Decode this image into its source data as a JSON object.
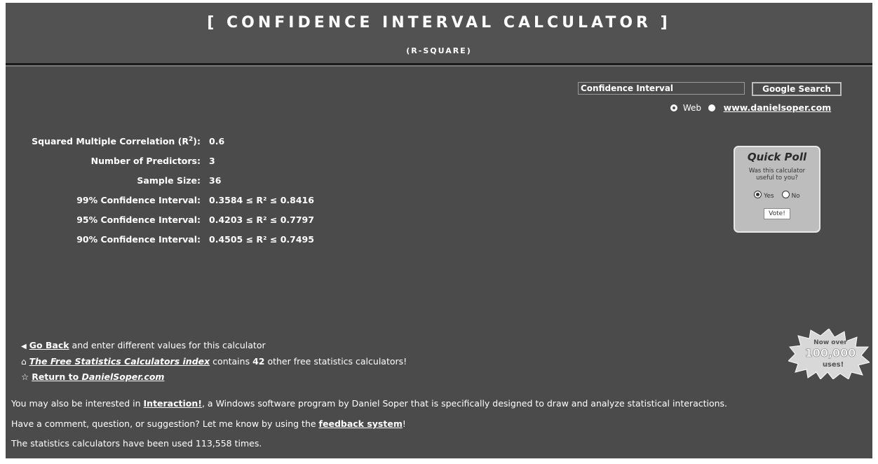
{
  "header": {
    "title": "[ CONFIDENCE INTERVAL CALCULATOR ]",
    "subtitle": "(R-SQUARE)"
  },
  "search": {
    "value": "Confidence Interval",
    "button_label": "Google Search",
    "option_web": "Web",
    "option_site": "www.danielsoper.com"
  },
  "results": {
    "rows": [
      {
        "label_pre": "Squared Multiple Correlation (R",
        "label_sup": "2",
        "label_post": "):",
        "value": "0.6"
      },
      {
        "label": "Number of Predictors:",
        "value": "3"
      },
      {
        "label": "Sample Size:",
        "value": "36"
      },
      {
        "label": "99% Confidence Interval:",
        "value": "0.3584 ≤ R² ≤ 0.8416"
      },
      {
        "label": "95% Confidence Interval:",
        "value": "0.4203 ≤ R² ≤ 0.7797"
      },
      {
        "label": "90% Confidence Interval:",
        "value": "0.4505 ≤ R² ≤ 0.7495"
      }
    ]
  },
  "poll": {
    "title": "Quick Poll",
    "question_line1": "Was this calculator",
    "question_line2": "useful to you?",
    "yes": "Yes",
    "no": "No",
    "vote_label": "Vote!"
  },
  "links": {
    "back_link": "Go Back",
    "back_rest": " and enter different values for this calculator",
    "index_link": "The Free Statistics Calculators index",
    "index_mid": " contains ",
    "index_count": "42",
    "index_rest": " other free statistics calculators!",
    "return_prefix": "Return to ",
    "return_site": "DanielSoper.com"
  },
  "badge": {
    "line1": "Now over",
    "line2": "100,000",
    "line3": "uses!"
  },
  "footer": {
    "interest_pre": "You may also be interested in ",
    "interest_link": "Interaction!",
    "interest_post": ", a Windows software program by Daniel Soper that is specifically designed to draw and analyze statistical interactions.",
    "comment_pre": "Have a comment, question, or suggestion? Let me know by using the ",
    "comment_link": "feedback system",
    "comment_post": "!",
    "usage": "The statistics calculators have been used 113,558 times."
  }
}
